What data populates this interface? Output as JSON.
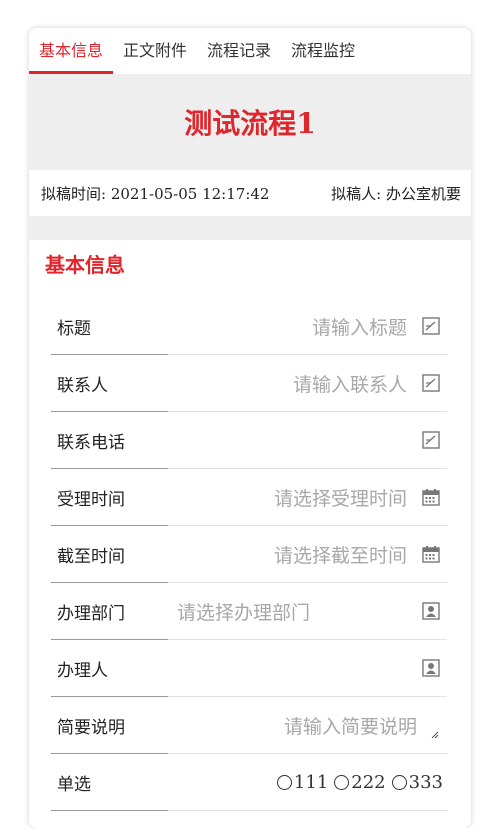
{
  "tabs": [
    {
      "label": "基本信息",
      "active": true
    },
    {
      "label": "正文附件",
      "active": false
    },
    {
      "label": "流程记录",
      "active": false
    },
    {
      "label": "流程监控",
      "active": false
    }
  ],
  "doc": {
    "title": "测试流程1",
    "draft_time_label": "拟稿时间:",
    "draft_time_value": "2021-05-05 12:17:42",
    "drafter_label": "拟稿人:",
    "drafter_value": "办公室机要"
  },
  "section": {
    "title": "基本信息"
  },
  "fields": {
    "title": {
      "label": "标题",
      "placeholder": "请输入标题",
      "icon": "edit-icon"
    },
    "contact": {
      "label": "联系人",
      "placeholder": "请输入联系人",
      "icon": "edit-icon"
    },
    "phone": {
      "label": "联系电话",
      "placeholder": "",
      "icon": "edit-icon"
    },
    "accept_time": {
      "label": "受理时间",
      "placeholder": "请选择受理时间",
      "icon": "calendar-icon"
    },
    "deadline": {
      "label": "截至时间",
      "placeholder": "请选择截至时间",
      "icon": "calendar-icon"
    },
    "department": {
      "label": "办理部门",
      "placeholder": "请选择办理部门",
      "icon": "contact-card-icon"
    },
    "handler": {
      "label": "办理人",
      "placeholder": "",
      "icon": "contact-card-icon"
    },
    "summary": {
      "label": "简要说明",
      "placeholder": "请输入简要说明"
    },
    "single_choice": {
      "label": "单选",
      "options": [
        "111",
        "222",
        "333"
      ]
    }
  },
  "colors": {
    "accent": "#e0262d",
    "title_bg": "#eeeeee"
  }
}
